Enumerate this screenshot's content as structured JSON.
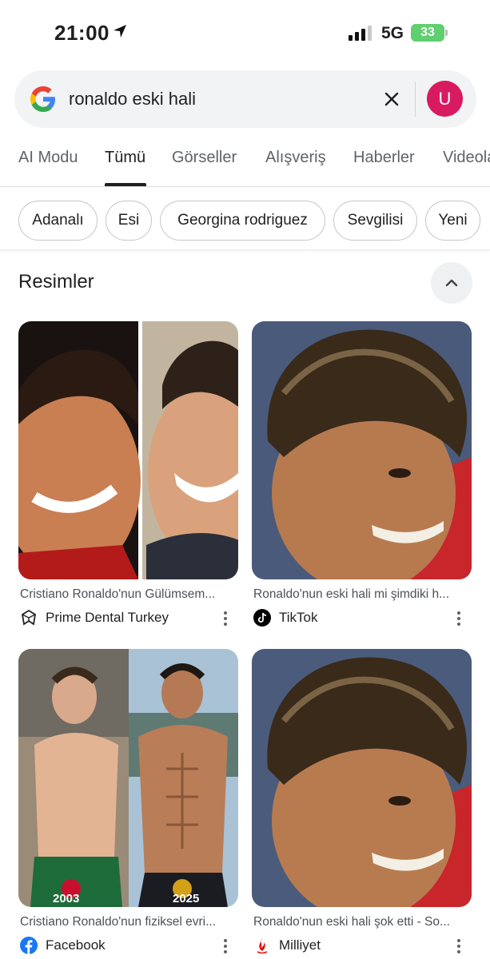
{
  "status_bar": {
    "time": "21:00",
    "network": "5G",
    "battery": "33"
  },
  "search": {
    "query": "ronaldo eski hali",
    "avatar_letter": "U"
  },
  "tabs": [
    "AI Modu",
    "Tümü",
    "Görseller",
    "Alışveriş",
    "Haberler",
    "Videola"
  ],
  "chips": [
    "Adanalı",
    "Esi",
    "Georgina rodriguez",
    "Sevgilisi",
    "Yeni"
  ],
  "images_section": {
    "title": "Resimler",
    "results": [
      {
        "caption": "Cristiano Ronaldo'nun Gülümsem...",
        "source": "Prime Dental Turkey",
        "icon": "prime-dental-icon"
      },
      {
        "caption": "Ronaldo'nun eski hali mi şimdiki h...",
        "source": "TikTok",
        "icon": "tiktok-icon"
      },
      {
        "caption": "Cristiano Ronaldo'nun fiziksel evri...",
        "source": "Facebook",
        "icon": "facebook-icon",
        "years": [
          "2003",
          "2025"
        ]
      },
      {
        "caption": "Ronaldo'nun eski hali şok etti - So...",
        "source": "Milliyet",
        "icon": "milliyet-icon"
      }
    ]
  },
  "colors": {
    "avatar": "#d81b60",
    "battery": "#5fcf6f",
    "facebook": "#1877f2",
    "milliyet": "#e3120b"
  }
}
